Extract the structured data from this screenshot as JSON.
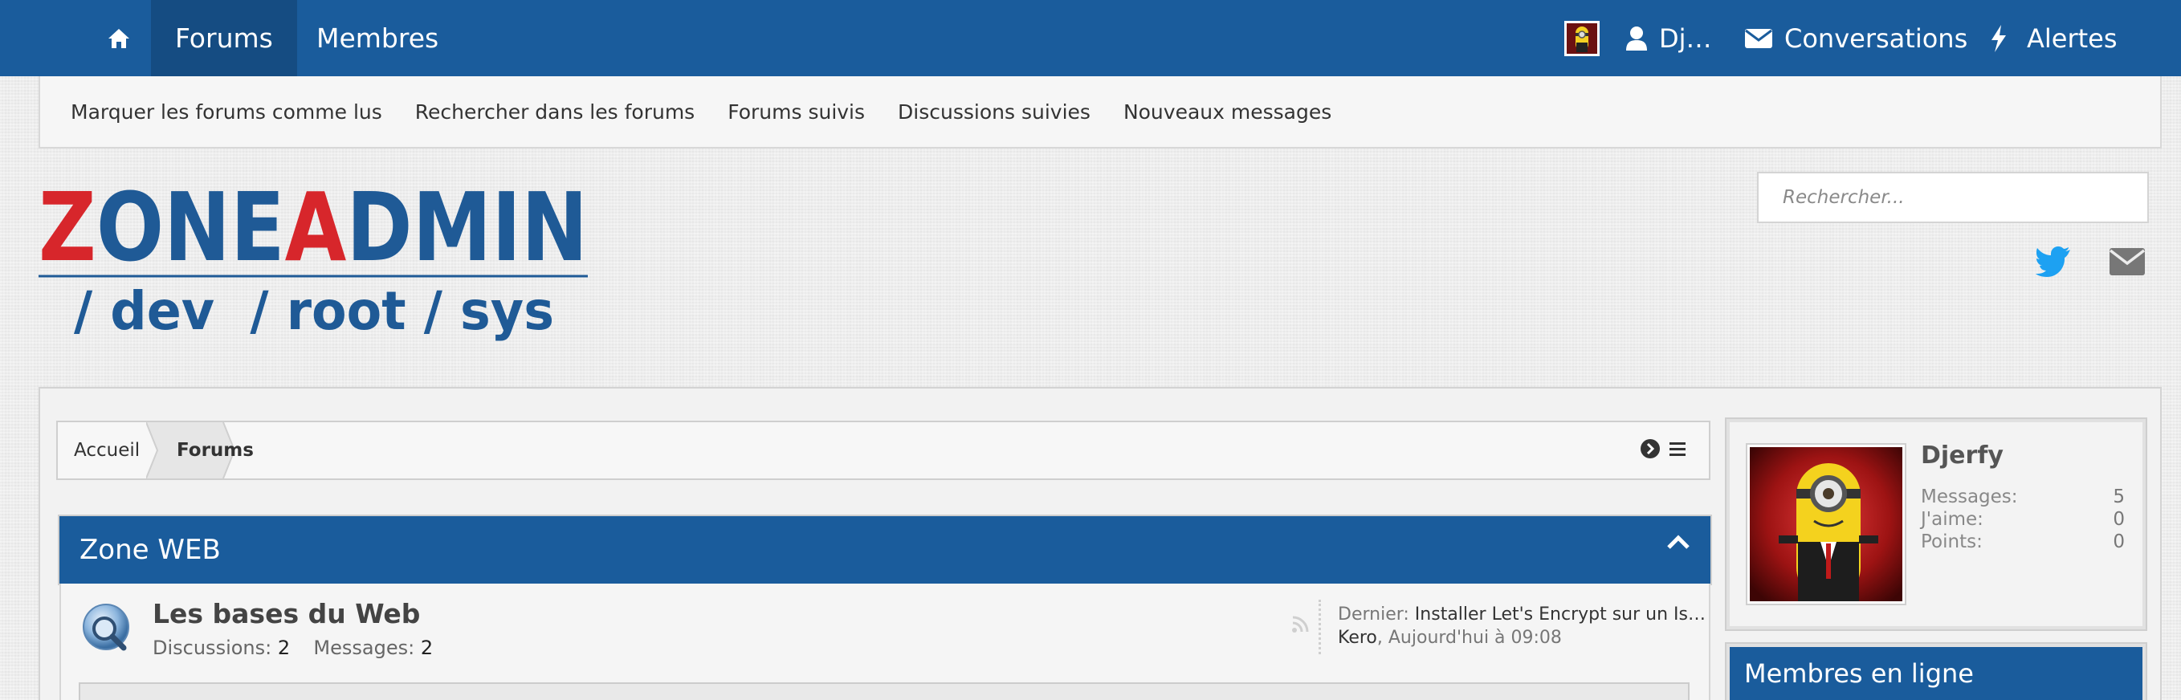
{
  "topnav": {
    "tabs": [
      {
        "label": "Forums",
        "active": true
      },
      {
        "label": "Membres",
        "active": false
      }
    ],
    "user": {
      "name": "Dj…"
    },
    "conversations_label": "Conversations",
    "alerts_label": "Alertes"
  },
  "subnav": {
    "links": [
      "Marquer les forums comme lus",
      "Rechercher dans les forums",
      "Forums suivis",
      "Discussions suivies",
      "Nouveaux messages"
    ]
  },
  "header": {
    "logo_text_top": "ZONEADMIN",
    "logo_text_bottom": "/ dev  / root / sys",
    "search_placeholder": "Rechercher..."
  },
  "breadcrumb": {
    "items": [
      "Accueil",
      "Forums"
    ]
  },
  "category": {
    "title": "Zone WEB",
    "forums": [
      {
        "title": "Les bases du Web",
        "discussions_label": "Discussions:",
        "discussions": "2",
        "messages_label": "Messages:",
        "messages": "2",
        "last_label": "Dernier:",
        "last_title": "Installer Let's Encrypt sur un Is…",
        "last_user": "Kero",
        "last_time": ", Aujourd'hui à 09:08"
      }
    ]
  },
  "sidebar": {
    "profile": {
      "name": "Djerfy",
      "stats": [
        {
          "label": "Messages:",
          "value": "5"
        },
        {
          "label": "J'aime:",
          "value": "0"
        },
        {
          "label": "Points:",
          "value": "0"
        }
      ]
    },
    "online_title": "Membres en ligne"
  },
  "colors": {
    "primary": "#1a5c9c",
    "logo_red": "#d7262b",
    "logo_blue": "#1f5a96",
    "twitter": "#1da1f2"
  }
}
